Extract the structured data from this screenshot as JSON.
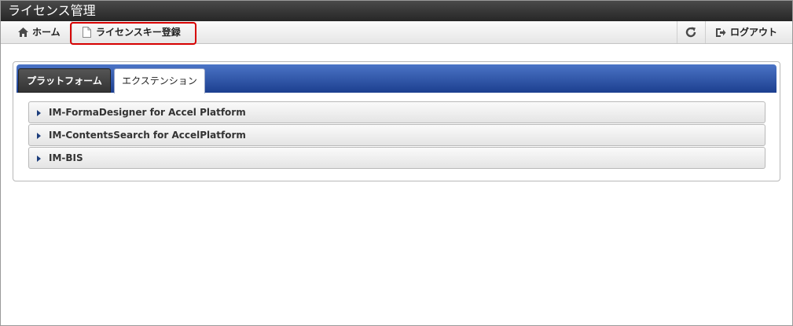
{
  "app": {
    "title": "ライセンス管理"
  },
  "toolbar": {
    "home_label": "ホーム",
    "home_icon": "home-icon",
    "register_label": "ライセンスキー登録",
    "register_icon": "document-icon",
    "refresh_icon": "refresh-icon",
    "logout_label": "ログアウト",
    "logout_icon": "logout-icon"
  },
  "tabs": [
    {
      "label": "プラットフォーム",
      "selected": false
    },
    {
      "label": "エクステンション",
      "selected": true
    }
  ],
  "accordion": [
    {
      "label": "IM-FormaDesigner for Accel Platform"
    },
    {
      "label": "IM-ContentsSearch for AccelPlatform"
    },
    {
      "label": "IM-BIS"
    }
  ],
  "colors": {
    "highlight": "#d60000",
    "tabbar": "#2a4f9f",
    "accordion_arrow": "#1d3e7c"
  }
}
